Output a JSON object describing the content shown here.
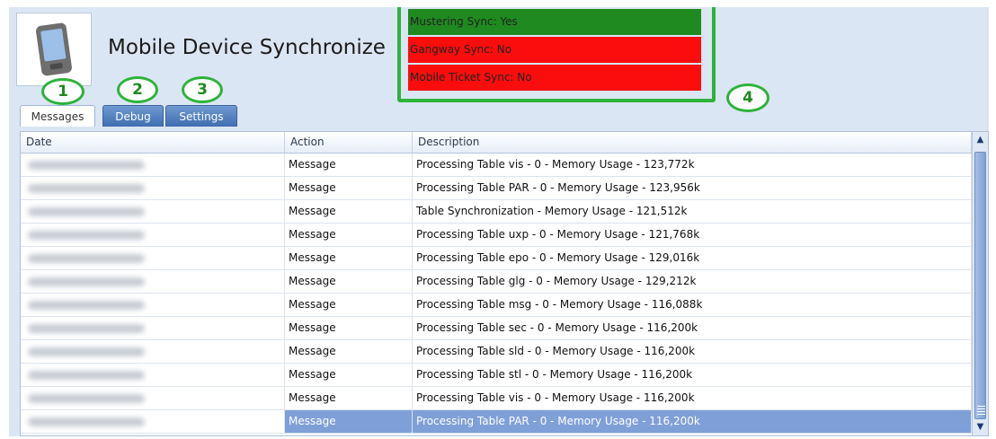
{
  "header": {
    "title": "Mobile Device Synchronize",
    "icon": "mobile-device-icon"
  },
  "status": [
    {
      "label": "Mustering Sync: Yes",
      "state": "ok",
      "color": "#1f8a1f"
    },
    {
      "label": "Gangway Sync: No",
      "state": "bad",
      "color": "#fb0d0d"
    },
    {
      "label": "Mobile Ticket Sync: No",
      "state": "bad",
      "color": "#fb0d0d"
    }
  ],
  "callouts": [
    "1",
    "2",
    "3",
    "4"
  ],
  "tabs": [
    {
      "label": "Messages",
      "active": true
    },
    {
      "label": "Debug",
      "active": false
    },
    {
      "label": "Settings",
      "active": false
    }
  ],
  "table": {
    "columns": [
      "Date",
      "Action",
      "Description"
    ],
    "rows": [
      {
        "date": "",
        "action": "Message",
        "description": "Processing Table vis - 0 - Memory Usage - 123,772k"
      },
      {
        "date": "",
        "action": "Message",
        "description": "Processing Table PAR - 0 - Memory Usage - 123,956k"
      },
      {
        "date": "",
        "action": "Message",
        "description": "Table Synchronization - Memory Usage - 121,512k"
      },
      {
        "date": "",
        "action": "Message",
        "description": "Processing Table uxp - 0 - Memory Usage - 121,768k"
      },
      {
        "date": "",
        "action": "Message",
        "description": "Processing Table epo - 0 - Memory Usage - 129,016k"
      },
      {
        "date": "",
        "action": "Message",
        "description": "Processing Table glg - 0 - Memory Usage - 129,212k"
      },
      {
        "date": "",
        "action": "Message",
        "description": "Processing Table msg - 0 - Memory Usage - 116,088k"
      },
      {
        "date": "",
        "action": "Message",
        "description": "Processing Table sec - 0 - Memory Usage - 116,200k"
      },
      {
        "date": "",
        "action": "Message",
        "description": "Processing Table sld - 0 - Memory Usage - 116,200k"
      },
      {
        "date": "",
        "action": "Message",
        "description": "Processing Table stl - 0 - Memory Usage - 116,200k"
      },
      {
        "date": "",
        "action": "Message",
        "description": "Processing Table vis - 0 - Memory Usage - 116,200k"
      },
      {
        "date": "",
        "action": "Message",
        "description": "Processing Table PAR - 0 - Memory Usage - 116,200k",
        "selected": true
      }
    ]
  },
  "scrollbar": {
    "up_icon": "scroll-up-arrow-icon",
    "down_icon": "scroll-down-arrow-icon"
  },
  "colors": {
    "accent": "#2db33a",
    "selection": "#7f9fd8",
    "ok": "#1f8a1f",
    "bad": "#fb0d0d"
  }
}
